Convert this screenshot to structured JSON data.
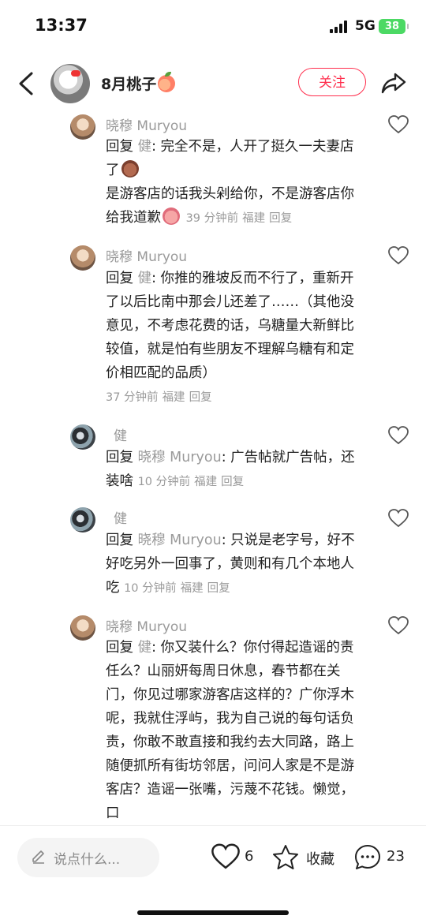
{
  "status_bar": {
    "time": "13:37",
    "network": "5G",
    "battery": "38"
  },
  "header": {
    "back_icon": "chevron-left-icon",
    "username": "8月桃子",
    "follow_label": "关注",
    "share_icon": "share-arrow-icon"
  },
  "comments": [
    {
      "user": "晓穆 Muryou",
      "reply_word": "回复",
      "reply_to": "健",
      "text_a": ": 完全不是，人开了挺久一夫妻店了",
      "text_b": "是游客店的话我头剁给你，不是游客店你给我道歉",
      "time": "39 分钟前",
      "location": "福建",
      "reply_label": "回复"
    },
    {
      "user": "晓穆 Muryou",
      "reply_word": "回复",
      "reply_to": "健",
      "text": ": 你推的雅坡反而不行了，重新开了以后比南中那会儿还差了……（其他没意见，不考虑花费的话，乌糖量大新鲜比较值，就是怕有些朋友不理解乌糖有和定价相匹配的品质）",
      "time": "37 分钟前",
      "location": "福建",
      "reply_label": "回复"
    },
    {
      "user": "健",
      "reply_word": "回复",
      "reply_to": "晓穆 Muryou",
      "text": ": 广告帖就广告帖，还装啥",
      "time": "10 分钟前",
      "location": "福建",
      "reply_label": "回复"
    },
    {
      "user": "健",
      "reply_word": "回复",
      "reply_to": "晓穆 Muryou",
      "text": ": 只说是老字号，好不好吃另外一回事了，黄则和有几个本地人吃",
      "time": "10 分钟前",
      "location": "福建",
      "reply_label": "回复"
    },
    {
      "user": "晓穆 Muryou",
      "reply_word": "回复",
      "reply_to": "健",
      "text": ": 你又装什么？你付得起造谣的责任么？山丽妍每周日休息，春节都在关门，你见过哪家游客店这样的？广你浮木呢，我就住浮屿，我为自己说的每句话负责，你敢不敢直接和我约去大同路，路上随便抓所有街坊邻居，问问人家是不是游客店？造谣一张嘴，污蔑不花钱。懒觉，口"
    }
  ],
  "bottom_bar": {
    "input_placeholder": "说点什么...",
    "likes": "6",
    "collect_label": "收藏",
    "comments_count": "23"
  }
}
